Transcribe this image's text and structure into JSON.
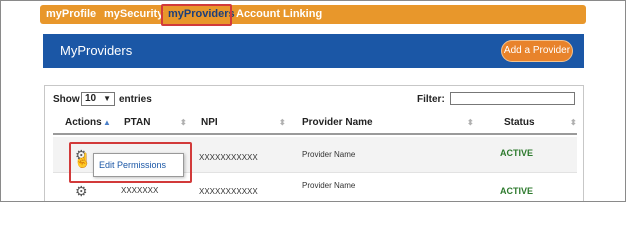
{
  "nav": {
    "items": [
      {
        "label": "myProfile"
      },
      {
        "label": "mySecurity"
      },
      {
        "label": "myProviders"
      },
      {
        "label": "Account Linking"
      }
    ],
    "active_index": 2
  },
  "header": {
    "title": "MyProviders",
    "add_button": "Add a Provider"
  },
  "table_controls": {
    "show_label": "Show",
    "entries_value": "10",
    "entries_label": "entries",
    "filter_label": "Filter:",
    "filter_value": ""
  },
  "table": {
    "columns": [
      "Actions",
      "PTAN",
      "NPI",
      "Provider Name",
      "Status"
    ],
    "rows": [
      {
        "ptan": "",
        "npi": "XXXXXXXXXXX",
        "provider_name": "Provider Name",
        "status": "ACTIVE"
      },
      {
        "ptan": "XXXXXXX",
        "npi": "XXXXXXXXXXX",
        "provider_name": "Provider Name",
        "status": "ACTIVE"
      }
    ]
  },
  "actions_menu": {
    "items": [
      "Edit Permissions"
    ]
  },
  "icons": {
    "row_action": "gear-icon",
    "pointer": "hand-pointer-icon",
    "select_arrow": "chevron-down-icon",
    "sort": "sort-arrows-icon"
  },
  "colors": {
    "nav_bar": "#e8972b",
    "header_bar": "#1b57a6",
    "accent_button": "#e8832b",
    "status_active": "#2d7a2d",
    "highlight_box": "#d23a3a"
  }
}
